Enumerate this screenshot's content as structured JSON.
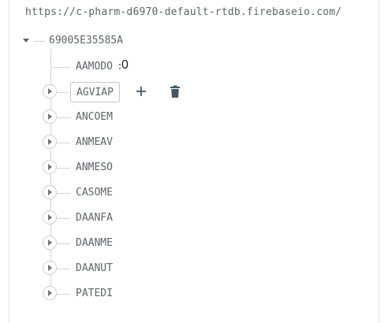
{
  "database": {
    "url": "https://c-pharm-d6970-default-rtdb.firebaseio.com/",
    "root_key": "69005E35585A"
  },
  "entries": [
    {
      "key": "AAMODO",
      "value": "0",
      "type": "leaf"
    },
    {
      "key": "AGVIAP",
      "type": "node",
      "hovered": true
    },
    {
      "key": "ANCOEM",
      "type": "node"
    },
    {
      "key": "ANMEAV",
      "type": "node"
    },
    {
      "key": "ANMESO",
      "type": "node"
    },
    {
      "key": "CASOME",
      "type": "node"
    },
    {
      "key": "DAANFA",
      "type": "node"
    },
    {
      "key": "DAANME",
      "type": "node"
    },
    {
      "key": "DAANUT",
      "type": "node"
    },
    {
      "key": "PATEDI",
      "type": "node"
    }
  ],
  "icons": {
    "add": "plus-icon",
    "delete": "trash-icon",
    "expand": "chevron-right-icon",
    "collapse": "caret-down-icon"
  },
  "colors": {
    "text": "#5f6368",
    "icon": "#455a64",
    "tree_line": "#d6d6d6"
  }
}
